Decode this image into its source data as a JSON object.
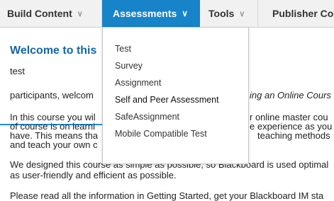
{
  "toolbar": {
    "items": [
      {
        "label": "Build Content"
      },
      {
        "label": "Assessments"
      },
      {
        "label": "Tools"
      },
      {
        "label": "Publisher Cor"
      }
    ]
  },
  "content": {
    "welcome": "Welcome to this",
    "test": "test",
    "line_participants_left": "participants, welcom",
    "line_participants_right": "ing an Online Cours",
    "para1": [
      {
        "left": "In this course you wil",
        "right": "r online master cou"
      },
      {
        "left": "of  course is on learni",
        "right": "e experience as you"
      },
      {
        "left": "have. This means tha",
        "right": "teaching methods"
      },
      {
        "left": "and teach your own c",
        "right": ""
      }
    ],
    "para2": [
      "We designed this course as simple as possible, so Blackboard is used optimal",
      "as user-friendly and efficient as possible."
    ],
    "para3_partial": "Please read all the information in Getting Started, get your Blackboard IM sta"
  },
  "dropdown": {
    "items": [
      {
        "label": "Test"
      },
      {
        "label": "Survey"
      },
      {
        "label": "Assignment"
      },
      {
        "label": "Self and Peer Assessment"
      },
      {
        "label": "SafeAssignment"
      },
      {
        "label": "Mobile Compatible Test"
      }
    ]
  },
  "colors": {
    "accent": "#1783c8",
    "arrow": "#1e8fd6",
    "heading": "#1466a8"
  }
}
